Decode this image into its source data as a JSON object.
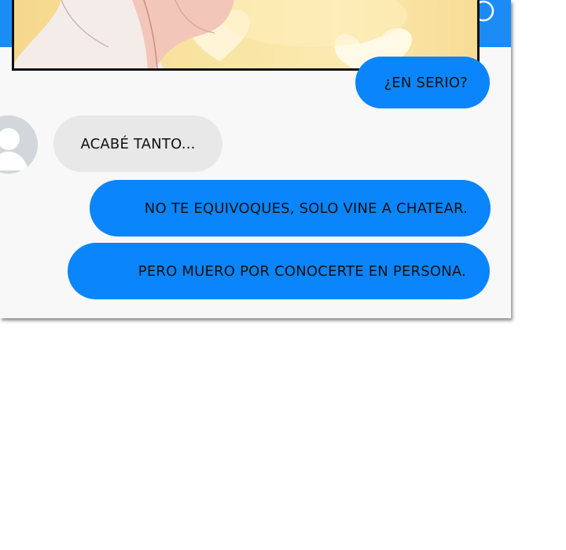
{
  "chat": {
    "messages": [
      {
        "direction": "outgoing",
        "text": "¿EN SERIO?"
      },
      {
        "direction": "incoming",
        "text": "ACABÉ TANTO..."
      },
      {
        "direction": "outgoing",
        "text": "NO TE EQUIVOQUES, SOLO VINE A CHATEAR."
      },
      {
        "direction": "outgoing",
        "text": "PERO MUERO POR CONOCERTE EN PERSONA."
      }
    ],
    "header_icon": "info-icon",
    "avatar_icon": "default-user-silhouette-icon"
  },
  "colors": {
    "header": "#1c8cf5",
    "outgoing_bubble": "#0a85fb",
    "incoming_bubble": "#e8e8e8",
    "chat_background": "#f8f8f8",
    "illustration_background": "#f8e3a0"
  }
}
